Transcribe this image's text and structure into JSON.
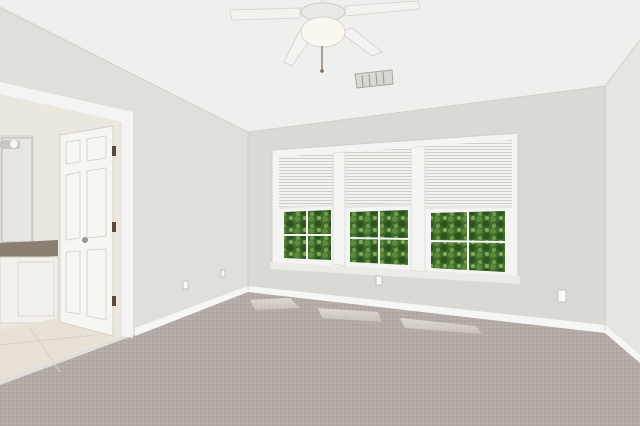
{
  "scene": {
    "colors": {
      "ceiling": "#efefed",
      "left_wall": "#e2e0dc",
      "back_wall": "#dcdad6",
      "right_wall": "#e6e4e1",
      "carpet": "#b4aca6",
      "trim": "#f7f7f5",
      "window_frame": "#f4f4f2",
      "blind": "#eeeeee",
      "foliage_dark": "#2f5a22",
      "foliage_light": "#6f9a48",
      "sunlight": "#d6d0ca",
      "bathroom_wall": "#ebe6dc",
      "bath_floor": "#e8e2d6",
      "vanity": "#f3f1ec",
      "counter": "#8a7f72",
      "door": "#f6f6f3",
      "hinge": "#5a4a3a"
    },
    "icons": [
      "ceiling-fan-icon",
      "air-vent-icon",
      "electrical-outlet-icon"
    ],
    "windows": [
      {
        "name": "window-left"
      },
      {
        "name": "window-center"
      },
      {
        "name": "window-right"
      }
    ]
  }
}
